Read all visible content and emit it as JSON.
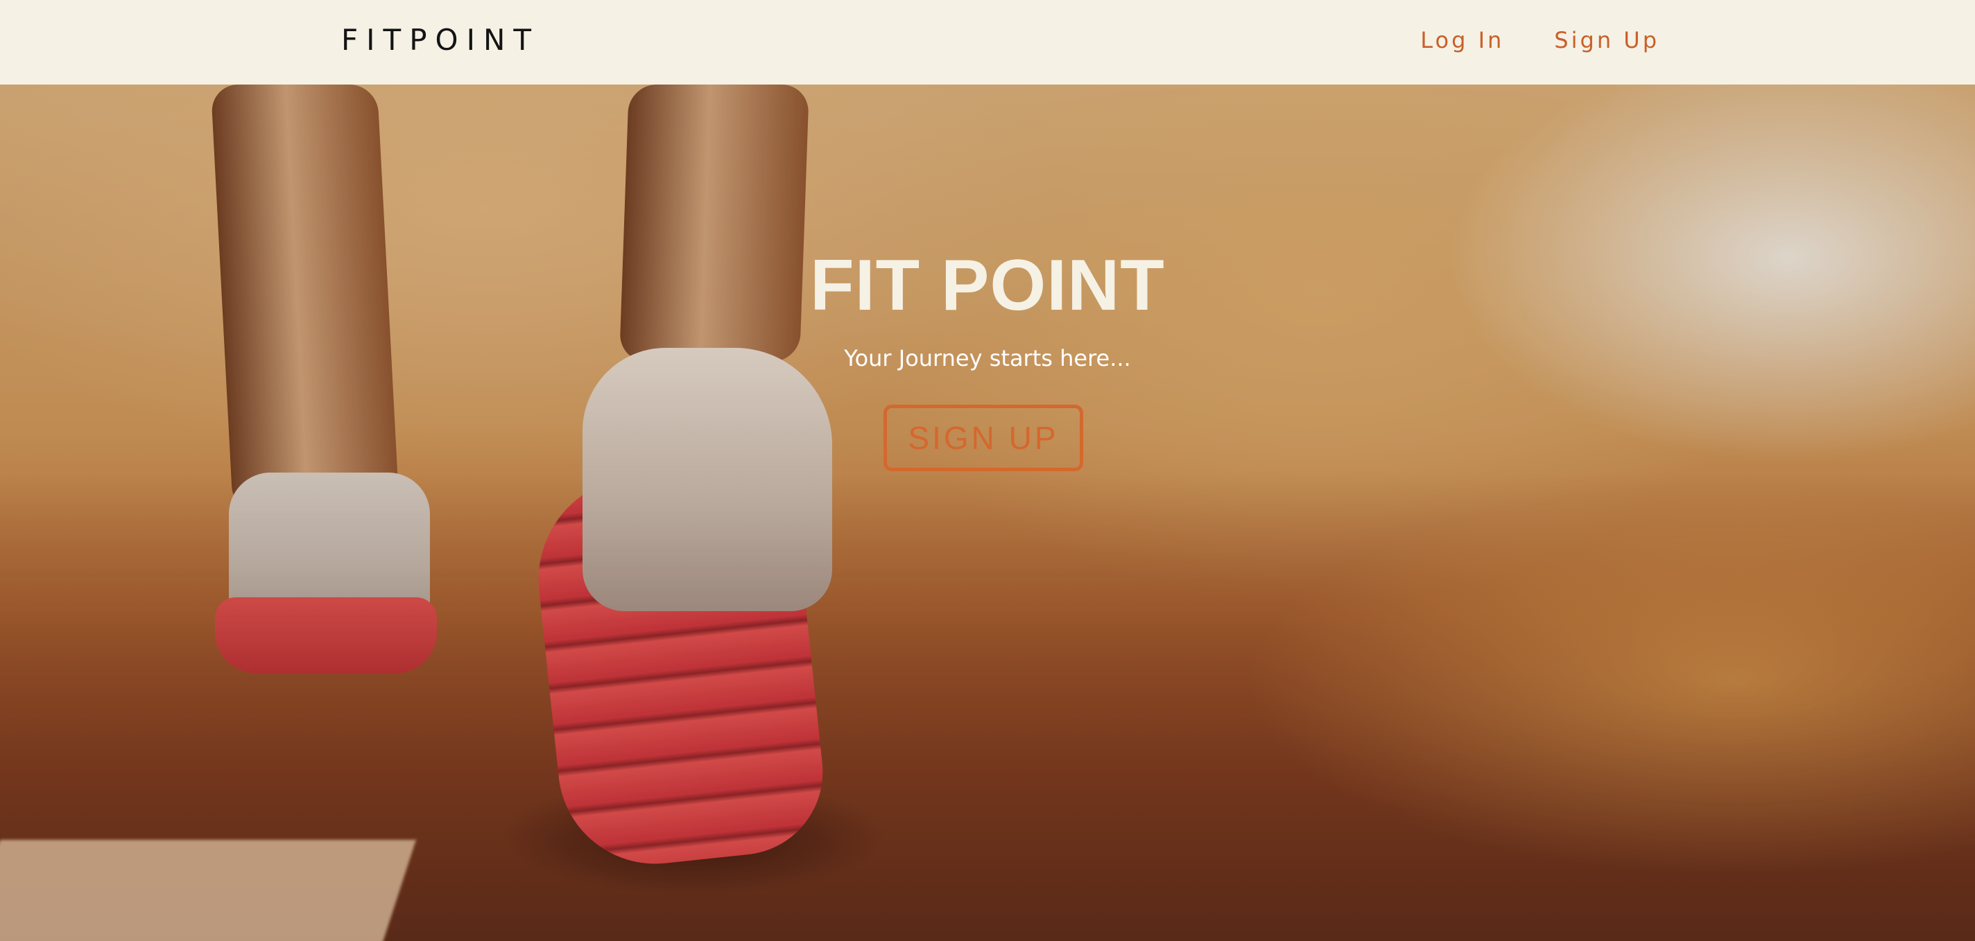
{
  "navbar": {
    "brand": "FITPOINT",
    "links": [
      {
        "label": "Log In"
      },
      {
        "label": "Sign Up"
      }
    ]
  },
  "hero": {
    "title": "FIT POINT",
    "subtitle": "Your Journey starts here...",
    "cta_label": "SIGN UP",
    "background_image": "running-shoes-on-road-image"
  },
  "colors": {
    "navbar_bg": "#f6f1e5",
    "brand_text": "#141414",
    "accent": "#d4682e",
    "hero_title": "#f6f1e5"
  }
}
